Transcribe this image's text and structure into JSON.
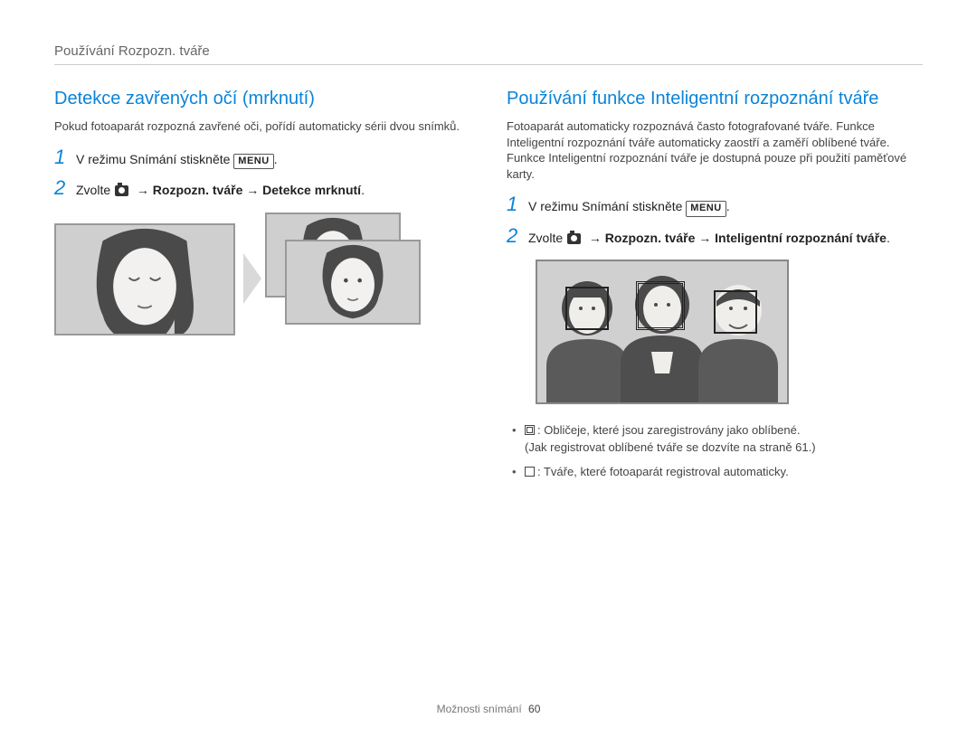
{
  "running_head": "Používání Rozpozn. tváře",
  "left": {
    "title": "Detekce zavřených očí (mrknutí)",
    "intro": "Pokud fotoaparát rozpozná zavřené oči, pořídí automaticky sérii dvou snímků.",
    "step1_pre": "V režimu Snímání stiskněte ",
    "menu_label": "MENU",
    "step1_post": ".",
    "step2_pre": "Zvolte ",
    "step2_mid1": " → Rozpozn. tváře → Detekce mrknutí",
    "step2_post": "."
  },
  "right": {
    "title": "Používání funkce Inteligentní rozpoznání tváře",
    "intro": "Fotoaparát automaticky rozpoznává často fotografované tváře. Funkce Inteligentní rozpoznání tváře automaticky zaostří a zaměří oblíbené tváře. Funkce Inteligentní rozpoznání tváře je dostupná pouze při použití paměťové karty.",
    "step1_pre": "V režimu Snímání stiskněte ",
    "menu_label": "MENU",
    "step1_post": ".",
    "step2_pre": "Zvolte ",
    "step2_mid1": " → Rozpozn. tváře → Inteligentní rozpoznání tváře",
    "step2_post": ".",
    "bullet1_a": ": Obličeje, které jsou zaregistrovány jako oblíbené. ",
    "bullet1_b": "(Jak registrovat oblíbené tváře se dozvíte na straně 61.)",
    "bullet2": ": Tváře, které fotoaparát registroval automaticky."
  },
  "footer": {
    "section": "Možnosti snímání",
    "page": "60"
  }
}
